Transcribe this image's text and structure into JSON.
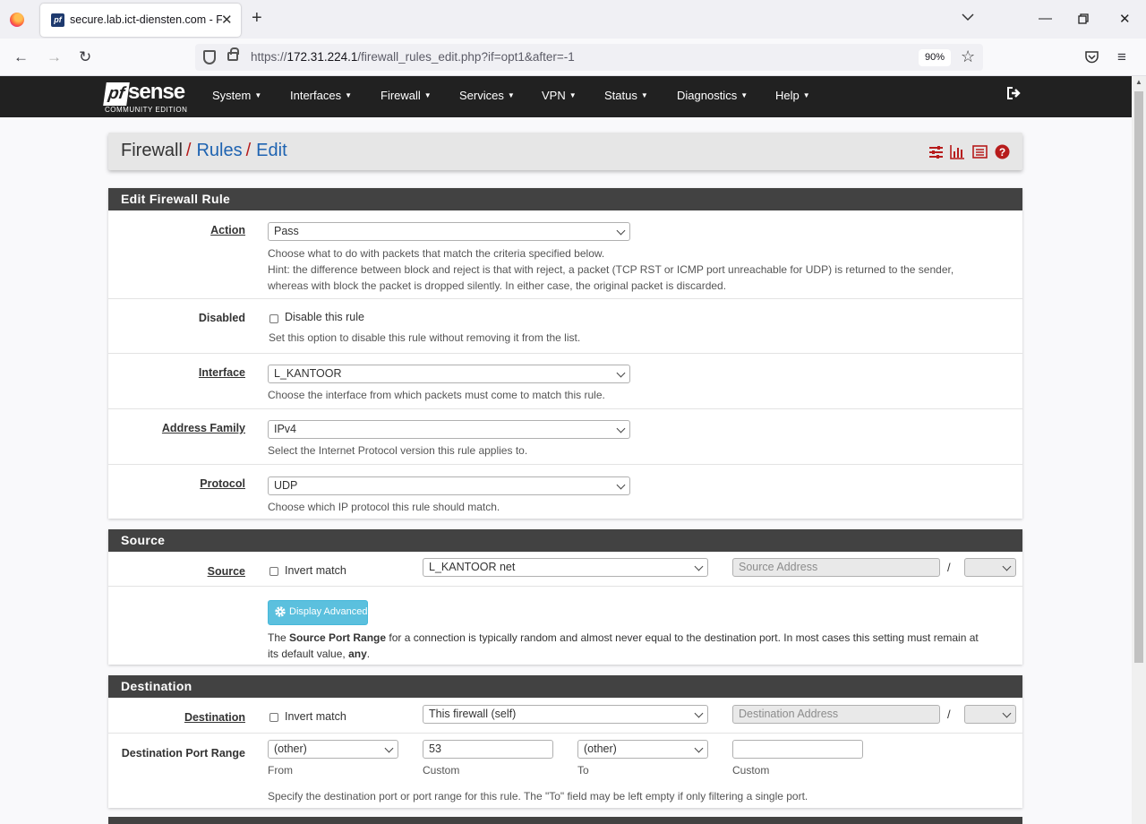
{
  "browser": {
    "tab_title": "secure.lab.ict-diensten.com - Firewall: Rules: Edit",
    "tab_favicon": "pf",
    "url_prefix": "https://",
    "url_host": "172.31.224.1",
    "url_path": "/firewall_rules_edit.php?if=opt1&after=-1",
    "zoom": "90%"
  },
  "pf": {
    "logo_mark": "pf",
    "logo_word": "sense",
    "logo_sub": "COMMUNITY EDITION",
    "menu": [
      "System",
      "Interfaces",
      "Firewall",
      "Services",
      "VPN",
      "Status",
      "Diagnostics",
      "Help"
    ]
  },
  "breadcrumb": {
    "first": "Firewall",
    "second": "Rules",
    "third": "Edit"
  },
  "edit_panel": {
    "title": "Edit Firewall Rule",
    "action": {
      "label": "Action",
      "value": "Pass",
      "help1": "Choose what to do with packets that match the criteria specified below.",
      "help2": "Hint: the difference between block and reject is that with reject, a packet (TCP RST or ICMP port unreachable for UDP) is returned to the sender,",
      "help3": "whereas with block the packet is dropped silently. In either case, the original packet is discarded."
    },
    "disabled": {
      "label": "Disabled",
      "checkbox": "Disable this rule",
      "help": "Set this option to disable this rule without removing it from the list."
    },
    "interface": {
      "label": "Interface",
      "value": "L_KANTOOR",
      "help": "Choose the interface from which packets must come to match this rule."
    },
    "family": {
      "label": "Address Family",
      "value": "IPv4",
      "help": "Select the Internet Protocol version this rule applies to."
    },
    "protocol": {
      "label": "Protocol",
      "value": "UDP",
      "help": "Choose which IP protocol this rule should match."
    }
  },
  "source_panel": {
    "title": "Source",
    "label": "Source",
    "invert": "Invert match",
    "type": "L_KANTOOR net",
    "address_placeholder": "Source Address",
    "slash": "/",
    "advanced_button": "Display Advanced",
    "help_pre": "The ",
    "help_bold": "Source Port Range",
    "help_mid": " for a connection is typically random and almost never equal to the destination port. In most cases this setting must remain at",
    "help_line2_pre": "its default value, ",
    "help_bold2": "any",
    "help_end": "."
  },
  "dest_panel": {
    "title": "Destination",
    "label": "Destination",
    "invert": "Invert match",
    "type": "This firewall (self)",
    "address_placeholder": "Destination Address",
    "slash": "/",
    "port_label": "Destination Port Range",
    "from_select": "(other)",
    "from_custom": "53",
    "to_select": "(other)",
    "to_custom": "",
    "from_label": "From",
    "custom_label": "Custom",
    "to_label": "To",
    "custom_label2": "Custom",
    "help": "Specify the destination port or port range for this rule. The \"To\" field may be left empty if only filtering a single port."
  },
  "colors": {
    "nav_bg": "#212121",
    "panel_head": "#424242",
    "link": "#1e63b1",
    "accent_red": "#b71c1c",
    "info_button": "#5bc0de"
  }
}
